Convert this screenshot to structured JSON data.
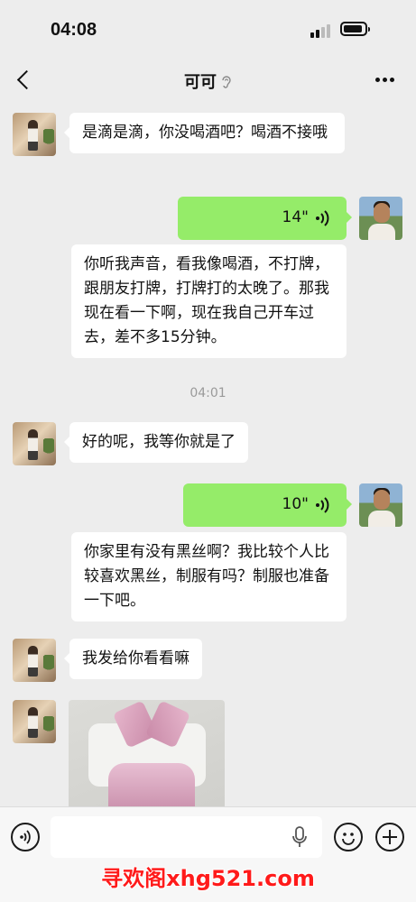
{
  "status_bar": {
    "time": "04:08"
  },
  "header": {
    "title": "可可"
  },
  "messages": [
    {
      "from": "contact",
      "type": "text",
      "text": "是滴是滴，你没喝酒吧？喝酒不接哦"
    },
    {
      "from": "me",
      "type": "voice",
      "duration": "14\""
    },
    {
      "from": "me",
      "type": "voice_transcript",
      "text": "你听我声音，看我像喝酒，不打牌，跟朋友打牌，打牌打的太晚了。那我现在看一下啊，现在我自己开车过去，差不多15分钟。"
    },
    {
      "type": "timestamp",
      "text": "04:01"
    },
    {
      "from": "contact",
      "type": "text",
      "text": "好的呢，我等你就是了"
    },
    {
      "from": "me",
      "type": "voice",
      "duration": "10\""
    },
    {
      "from": "me",
      "type": "voice_transcript",
      "text": "你家里有没有黑丝啊？我比较个人比较喜欢黑丝，制服有吗？制服也准备一下吧。"
    },
    {
      "from": "contact",
      "type": "text",
      "text": "我发给你看看嘛"
    },
    {
      "from": "contact",
      "type": "image"
    }
  ],
  "input_bar": {
    "placeholder": ""
  },
  "watermark": {
    "text": "寻欢阁xhg521.com"
  },
  "colors": {
    "background": "#ededed",
    "my_bubble": "#95ec69",
    "their_bubble": "#ffffff",
    "watermark": "#ff1a1a"
  },
  "icons": [
    "back-icon",
    "ear-icon",
    "more-icon",
    "voice-wave-icon",
    "voice-mode-icon",
    "mic-icon",
    "emoji-icon",
    "plus-icon"
  ]
}
